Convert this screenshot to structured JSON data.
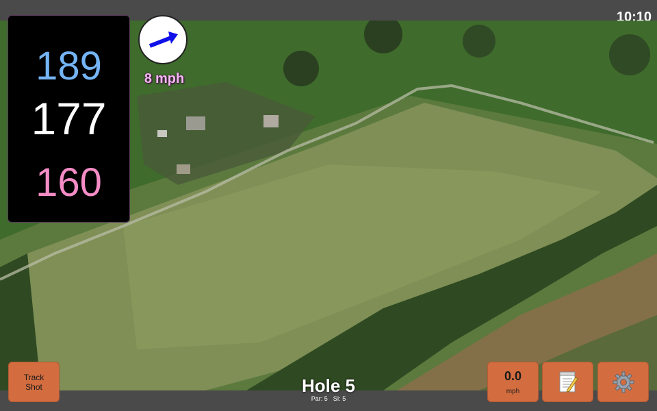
{
  "status": {
    "time": "10:10"
  },
  "yardage": {
    "back": "189",
    "middle": "177",
    "front": "160"
  },
  "wind": {
    "speed": "8",
    "unit": "mph",
    "direction_icon": "wind-arrow-icon"
  },
  "hole": {
    "title": "Hole 5",
    "par": "Par: 5",
    "si": "SI: 5"
  },
  "buttons": {
    "track_line1": "Track",
    "track_line2": "Shot",
    "speed_value": "0.0",
    "speed_unit": "mph",
    "notes_icon": "notepad-icon",
    "settings_icon": "gear-icon"
  },
  "colors": {
    "back": "#74b4f4",
    "middle": "#ffffff",
    "front": "#f58cc6",
    "button": "#d36d3f",
    "wind_label": "#f4b8f0"
  }
}
